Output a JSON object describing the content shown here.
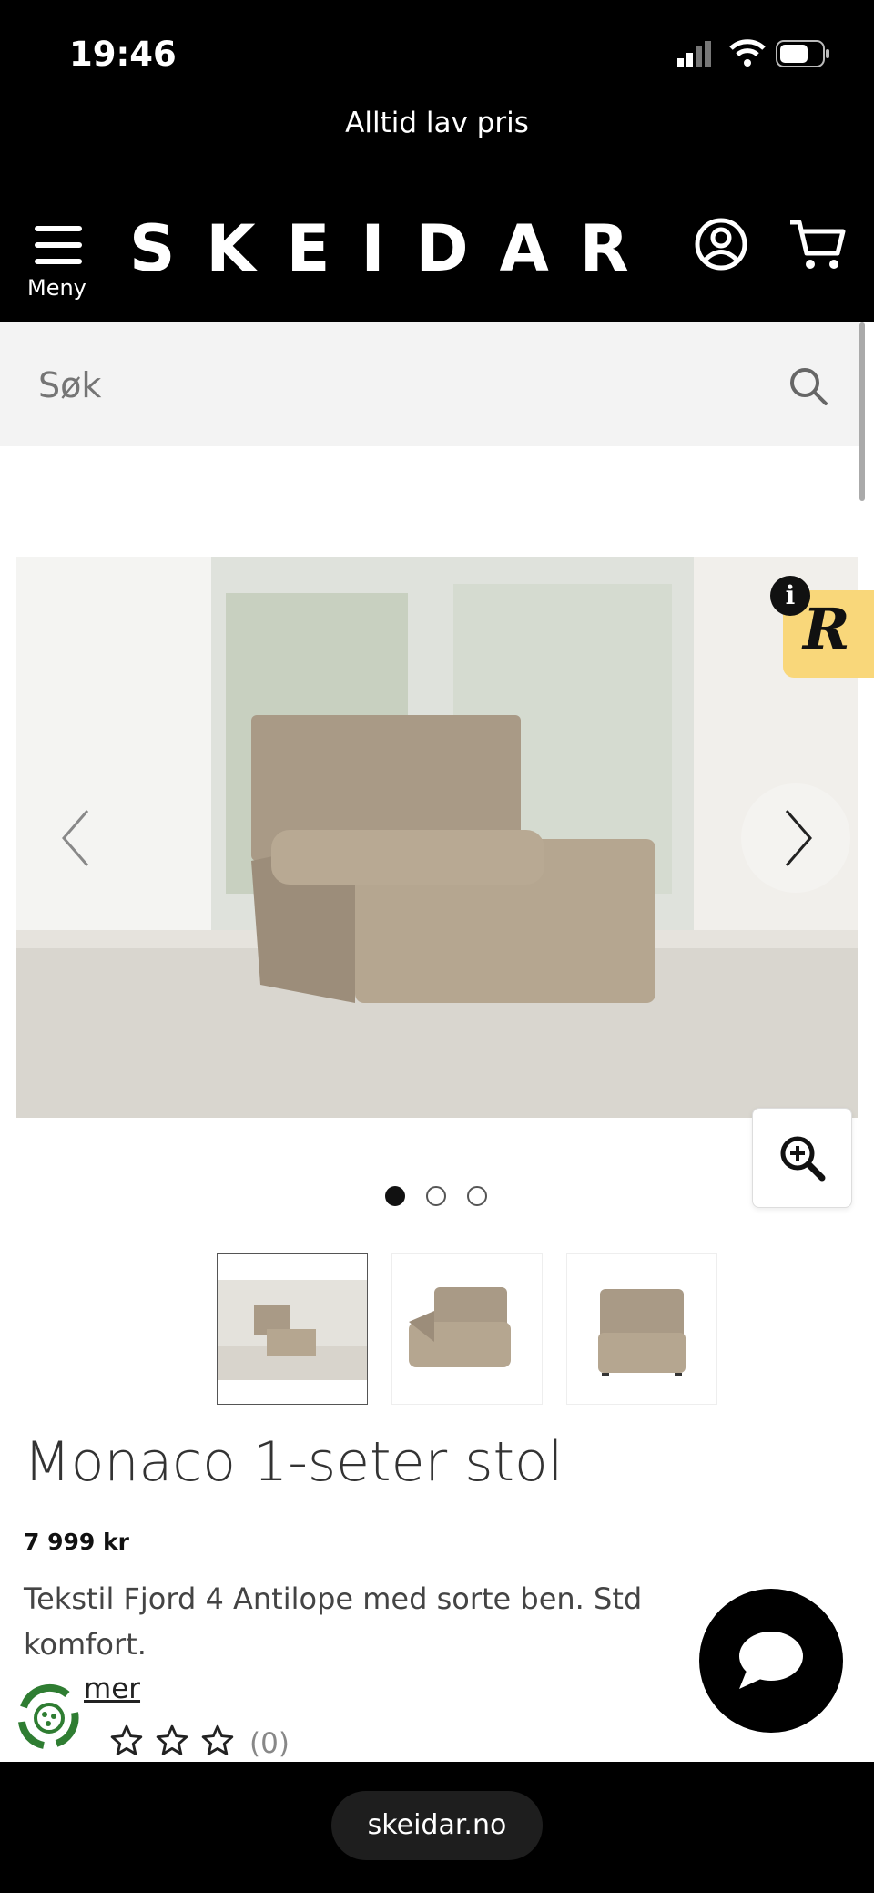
{
  "status_bar": {
    "time": "19:46"
  },
  "promo": {
    "text": "Alltid lav pris"
  },
  "header": {
    "logo": "SKEIDAR",
    "menu_label": "Meny"
  },
  "search": {
    "placeholder": "Søk"
  },
  "gallery": {
    "slide_count": 3,
    "active_slide": 1,
    "thumbnail_count": 3
  },
  "product": {
    "title": "Monaco 1-seter stol",
    "price": "7 999 kr",
    "description": "Tekstil Fjord 4 Antilope med sorte ben. Std komfort.",
    "more_link": "mer",
    "rating_count": "(0)"
  },
  "browser": {
    "url": "skeidar.no"
  },
  "colors": {
    "header_bg": "#000000",
    "search_bg": "#f3f3f3",
    "badge_yellow": "#f9d77a"
  }
}
